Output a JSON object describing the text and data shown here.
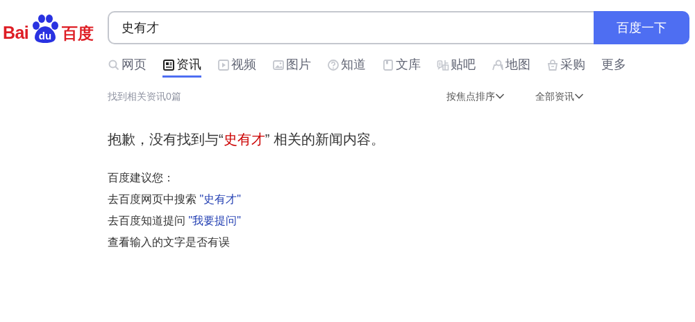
{
  "logo": {
    "left": "Bai",
    "paw": "du",
    "right": "百度"
  },
  "search": {
    "value": "史有才",
    "button": "百度一下"
  },
  "tabs": [
    {
      "label": "网页",
      "selected": false
    },
    {
      "label": "资讯",
      "selected": true
    },
    {
      "label": "视频",
      "selected": false
    },
    {
      "label": "图片",
      "selected": false
    },
    {
      "label": "知道",
      "selected": false
    },
    {
      "label": "文库",
      "selected": false
    },
    {
      "label": "贴吧",
      "selected": false
    },
    {
      "label": "地图",
      "selected": false
    },
    {
      "label": "采购",
      "selected": false
    },
    {
      "label": "更多",
      "selected": false
    }
  ],
  "result_count": "找到相关资讯0篇",
  "filters": [
    "按焦点排序",
    "全部资讯"
  ],
  "message": {
    "before": "抱歉，没有找到与“",
    "query": "史有才",
    "after": "” 相关的新闻内容。"
  },
  "suggestion_title": "百度建议您：",
  "suggestions": [
    {
      "text": "去百度网页中搜索 ",
      "link": "\"史有才\""
    },
    {
      "text": "去百度知道提问 ",
      "link": "\"我要提问\""
    },
    {
      "text": "查看输入的文字是否有误"
    }
  ]
}
